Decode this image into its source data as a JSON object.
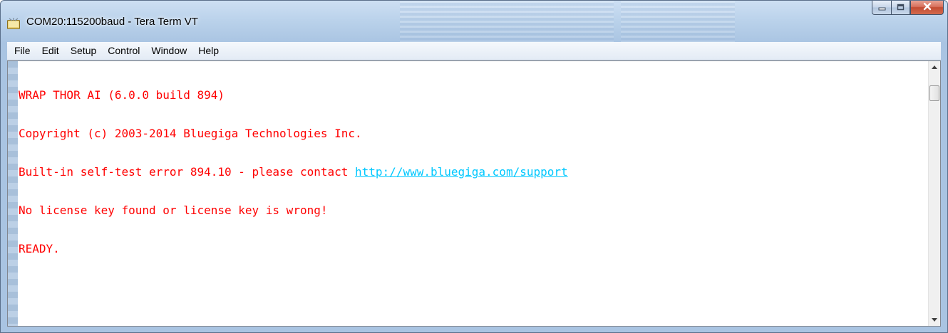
{
  "window": {
    "title": "COM20:115200baud - Tera Term VT",
    "minimize_glyph": "minimize",
    "maximize_glyph": "maximize",
    "close_glyph": "close",
    "accent": "#b9d1ea",
    "close_color": "#c24c32"
  },
  "menu": {
    "items": [
      {
        "label": "File"
      },
      {
        "label": "Edit"
      },
      {
        "label": "Setup"
      },
      {
        "label": "Control"
      },
      {
        "label": "Window"
      },
      {
        "label": "Help"
      }
    ]
  },
  "terminal": {
    "text_color": "#ff0000",
    "link_color": "#00c8ff",
    "lines": [
      "WRAP THOR AI (6.0.0 build 894)",
      "Copyright (c) 2003-2014 Bluegiga Technologies Inc.",
      "Built-in self-test error 894.10 - please contact ",
      "No license key found or license key is wrong!",
      "READY."
    ],
    "link": "http://www.bluegiga.com/support"
  },
  "scrollbar": {
    "up_icon": "scroll-up-arrow",
    "down_icon": "scroll-down-arrow"
  }
}
